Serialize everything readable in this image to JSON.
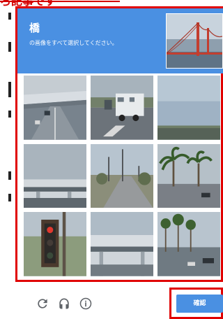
{
  "top_text": "ろ記事です",
  "captcha": {
    "title": "橋",
    "instruction": "の画像をすべて選択してください。",
    "tiles": [
      {
        "name": "overpass-highway"
      },
      {
        "name": "road-with-trailer"
      },
      {
        "name": "sky-horizon"
      },
      {
        "name": "highway-overpass-bridge"
      },
      {
        "name": "street-with-utility-poles"
      },
      {
        "name": "palm-trees-street"
      },
      {
        "name": "traffic-light"
      },
      {
        "name": "overpass-highway-2"
      },
      {
        "name": "palm-lined-road"
      }
    ]
  },
  "footer": {
    "reload_icon": "reload-icon",
    "audio_icon": "headphones-icon",
    "info_icon": "info-icon",
    "verify_label": "確認"
  },
  "colors": {
    "accent": "#4a90e2",
    "highlight_red": "#e00000"
  }
}
